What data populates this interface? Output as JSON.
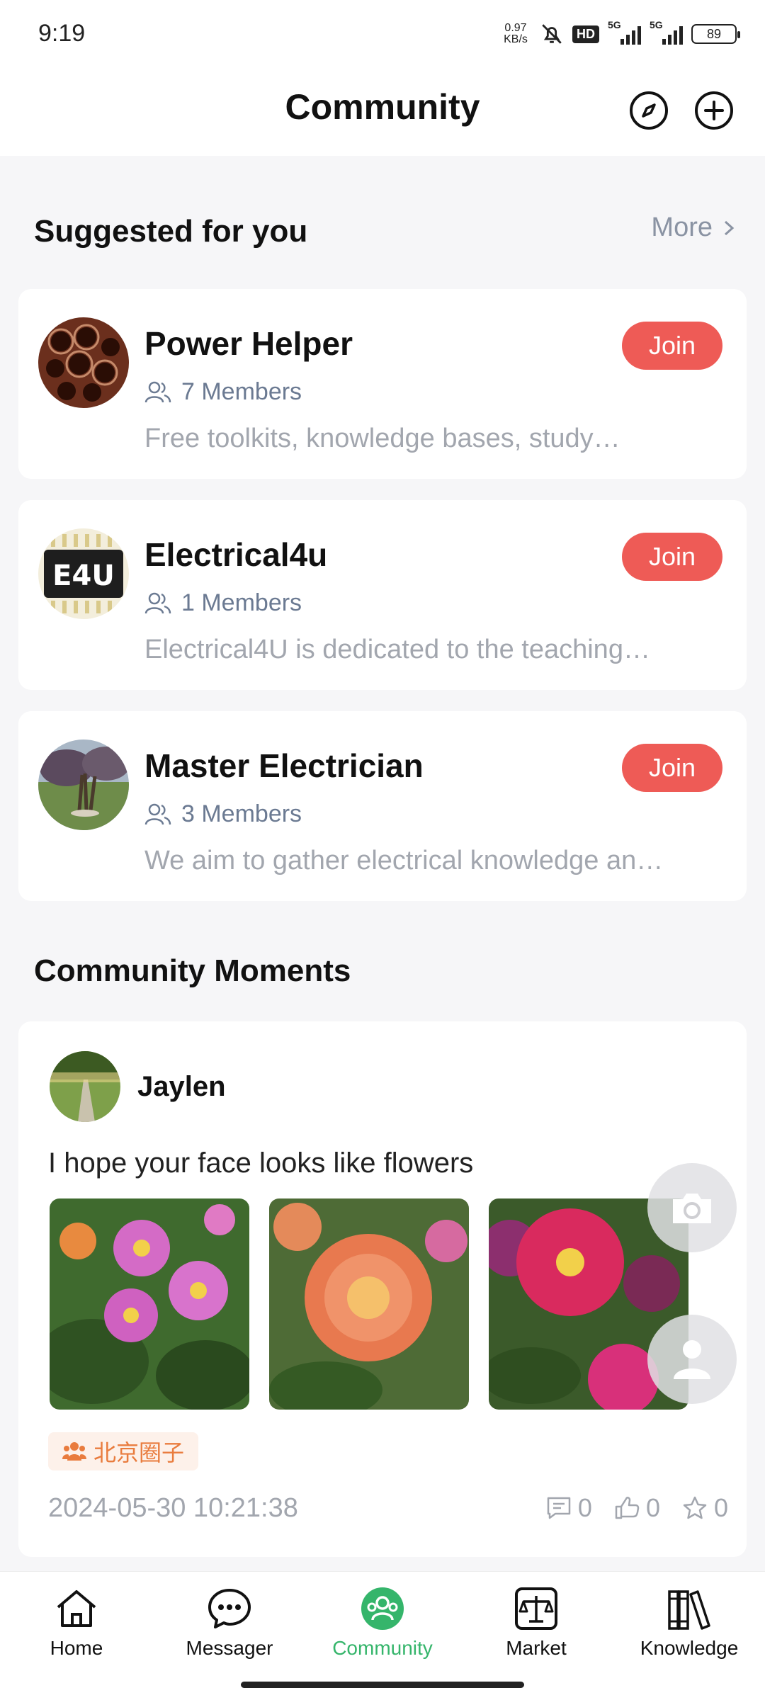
{
  "status_bar": {
    "time": "9:19",
    "net_speed_value": "0.97",
    "net_speed_unit": "KB/s",
    "hd_label": "HD",
    "signal1_label": "5G",
    "signal2_label": "5G",
    "battery": "89"
  },
  "header": {
    "title": "Community",
    "icons": [
      "compass-icon",
      "add-icon"
    ]
  },
  "suggested": {
    "title": "Suggested for you",
    "more_label": "More",
    "groups": [
      {
        "name": "Power Helper",
        "members": "7 Members",
        "description": "Free toolkits, knowledge bases, study…",
        "join_label": "Join"
      },
      {
        "name": "Electrical4u",
        "members": "1 Members",
        "description": "Electrical4U is dedicated to the teaching…",
        "join_label": "Join",
        "logo_text": "E4U"
      },
      {
        "name": "Master Electrician",
        "members": "3 Members",
        "description": "We aim to gather electrical knowledge an…",
        "join_label": "Join"
      }
    ]
  },
  "moments": {
    "title": "Community Moments",
    "post": {
      "author": "Jaylen",
      "text": "I hope your face looks like flowers",
      "tag": "北京圈子",
      "timestamp": "2024-05-30 10:21:38",
      "comments": "0",
      "likes": "0",
      "favorites": "0"
    }
  },
  "bottom_nav": {
    "items": [
      {
        "label": "Home",
        "icon": "home-icon"
      },
      {
        "label": "Messager",
        "icon": "chat-icon"
      },
      {
        "label": "Community",
        "icon": "community-icon",
        "active": true
      },
      {
        "label": "Market",
        "icon": "scale-icon"
      },
      {
        "label": "Knowledge",
        "icon": "books-icon"
      }
    ]
  },
  "colors": {
    "accent_join": "#ee5b56",
    "active_nav": "#35b56b",
    "tag_text": "#e97c3e",
    "tag_bg": "#fdf1ea"
  }
}
